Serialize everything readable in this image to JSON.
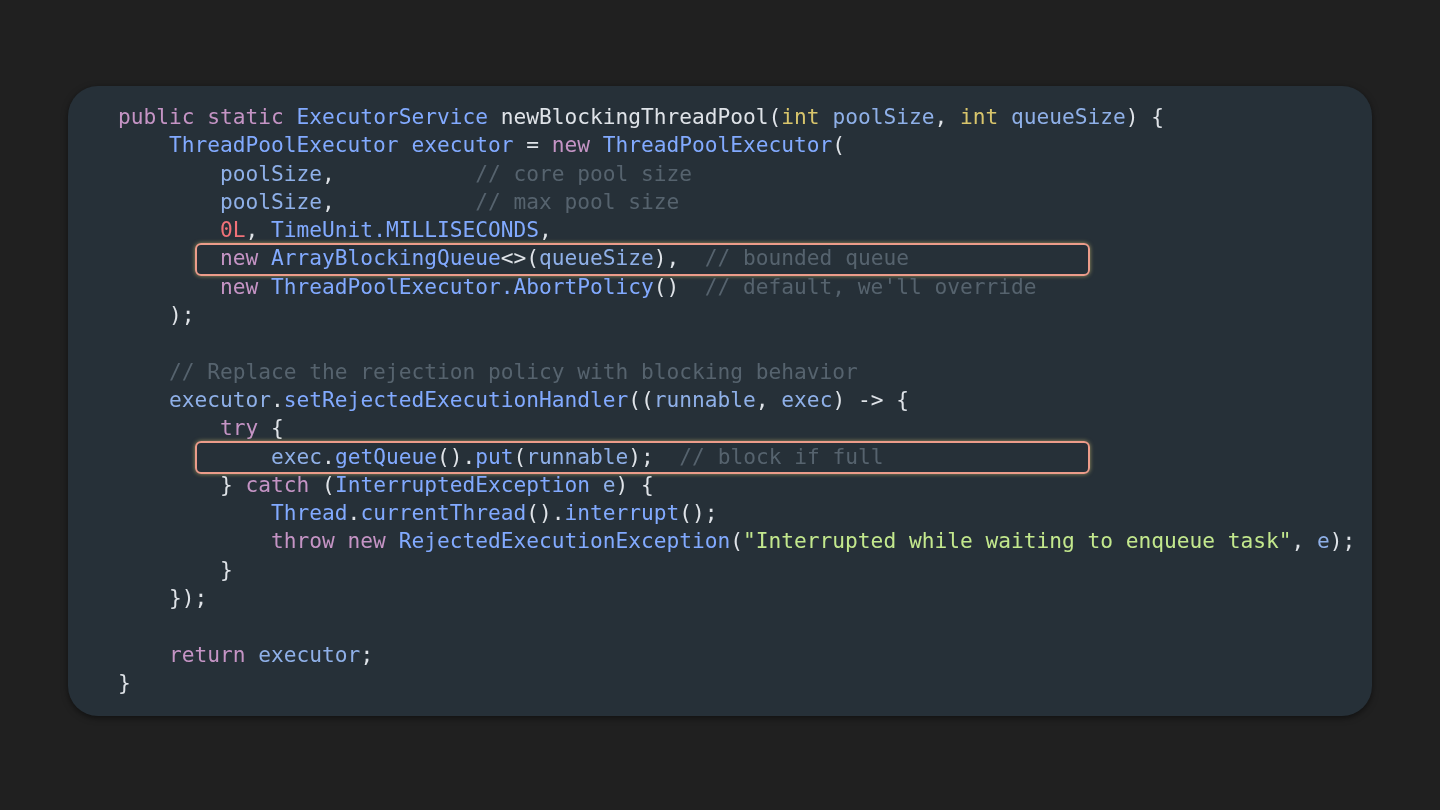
{
  "code_lines": [
    {
      "highlighted": false,
      "tokens": [
        {
          "kind": "keyword",
          "text": "public static "
        },
        {
          "kind": "type",
          "text": "ExecutorService "
        },
        {
          "kind": "plain",
          "text": "newBlockingThreadPool("
        },
        {
          "kind": "primitive",
          "text": "int "
        },
        {
          "kind": "ident",
          "text": "poolSize"
        },
        {
          "kind": "plain",
          "text": ", "
        },
        {
          "kind": "primitive",
          "text": "int "
        },
        {
          "kind": "ident",
          "text": "queueSize"
        },
        {
          "kind": "plain",
          "text": ") {"
        }
      ]
    },
    {
      "highlighted": false,
      "tokens": [
        {
          "kind": "type",
          "text": "    ThreadPoolExecutor executor "
        },
        {
          "kind": "plain",
          "text": "= "
        },
        {
          "kind": "keyword",
          "text": "new "
        },
        {
          "kind": "type",
          "text": "ThreadPoolExecutor"
        },
        {
          "kind": "plain",
          "text": "("
        }
      ]
    },
    {
      "highlighted": false,
      "tokens": [
        {
          "kind": "ident",
          "text": "        poolSize"
        },
        {
          "kind": "plain",
          "text": ",           "
        },
        {
          "kind": "comment",
          "text": "// core pool size"
        }
      ]
    },
    {
      "highlighted": false,
      "tokens": [
        {
          "kind": "ident",
          "text": "        poolSize"
        },
        {
          "kind": "plain",
          "text": ",           "
        },
        {
          "kind": "comment",
          "text": "// max pool size"
        }
      ]
    },
    {
      "highlighted": false,
      "tokens": [
        {
          "kind": "number",
          "text": "        0L"
        },
        {
          "kind": "plain",
          "text": ", "
        },
        {
          "kind": "type",
          "text": "TimeUnit.MILLISECONDS"
        },
        {
          "kind": "plain",
          "text": ","
        }
      ]
    },
    {
      "highlighted": true,
      "tokens": [
        {
          "kind": "keyword",
          "text": "        new "
        },
        {
          "kind": "type",
          "text": "ArrayBlockingQueue"
        },
        {
          "kind": "plain",
          "text": "<>("
        },
        {
          "kind": "ident",
          "text": "queueSize"
        },
        {
          "kind": "plain",
          "text": "),  "
        },
        {
          "kind": "comment",
          "text": "// bounded queue"
        }
      ]
    },
    {
      "highlighted": false,
      "tokens": [
        {
          "kind": "keyword",
          "text": "        new "
        },
        {
          "kind": "type",
          "text": "ThreadPoolExecutor.AbortPolicy"
        },
        {
          "kind": "plain",
          "text": "()  "
        },
        {
          "kind": "comment",
          "text": "// default, we'll override"
        }
      ]
    },
    {
      "highlighted": false,
      "tokens": [
        {
          "kind": "plain",
          "text": "    );"
        }
      ]
    },
    {
      "highlighted": false,
      "gap_before": true,
      "tokens": [
        {
          "kind": "comment",
          "text": "    // Replace the rejection policy with blocking behavior"
        }
      ]
    },
    {
      "highlighted": false,
      "tokens": [
        {
          "kind": "ident",
          "text": "    executor"
        },
        {
          "kind": "plain",
          "text": "."
        },
        {
          "kind": "type",
          "text": "setRejectedExecutionHandler"
        },
        {
          "kind": "plain",
          "text": "(("
        },
        {
          "kind": "ident",
          "text": "runnable"
        },
        {
          "kind": "plain",
          "text": ", "
        },
        {
          "kind": "ident",
          "text": "exec"
        },
        {
          "kind": "plain",
          "text": ") -> {"
        }
      ]
    },
    {
      "highlighted": false,
      "tokens": [
        {
          "kind": "keyword",
          "text": "        try "
        },
        {
          "kind": "plain",
          "text": "{"
        }
      ]
    },
    {
      "highlighted": true,
      "tokens": [
        {
          "kind": "ident",
          "text": "            exec"
        },
        {
          "kind": "plain",
          "text": "."
        },
        {
          "kind": "type",
          "text": "getQueue"
        },
        {
          "kind": "plain",
          "text": "()."
        },
        {
          "kind": "type",
          "text": "put"
        },
        {
          "kind": "plain",
          "text": "("
        },
        {
          "kind": "ident",
          "text": "runnable"
        },
        {
          "kind": "plain",
          "text": ");  "
        },
        {
          "kind": "comment",
          "text": "// block if full"
        }
      ]
    },
    {
      "highlighted": false,
      "tokens": [
        {
          "kind": "plain",
          "text": "        } "
        },
        {
          "kind": "keyword",
          "text": "catch "
        },
        {
          "kind": "plain",
          "text": "("
        },
        {
          "kind": "type",
          "text": "InterruptedException "
        },
        {
          "kind": "ident",
          "text": "e"
        },
        {
          "kind": "plain",
          "text": ") {"
        }
      ]
    },
    {
      "highlighted": false,
      "tokens": [
        {
          "kind": "type",
          "text": "            Thread"
        },
        {
          "kind": "plain",
          "text": "."
        },
        {
          "kind": "type",
          "text": "currentThread"
        },
        {
          "kind": "plain",
          "text": "()."
        },
        {
          "kind": "type",
          "text": "interrupt"
        },
        {
          "kind": "plain",
          "text": "();"
        }
      ]
    },
    {
      "highlighted": false,
      "tokens": [
        {
          "kind": "keyword",
          "text": "            throw new "
        },
        {
          "kind": "type",
          "text": "RejectedExecutionException"
        },
        {
          "kind": "plain",
          "text": "("
        },
        {
          "kind": "string",
          "text": "\"Interrupted while waiting to enqueue task\""
        },
        {
          "kind": "plain",
          "text": ", "
        },
        {
          "kind": "ident",
          "text": "e"
        },
        {
          "kind": "plain",
          "text": ");"
        }
      ]
    },
    {
      "highlighted": false,
      "tokens": [
        {
          "kind": "plain",
          "text": "        }"
        }
      ]
    },
    {
      "highlighted": false,
      "tokens": [
        {
          "kind": "plain",
          "text": "    });"
        }
      ]
    },
    {
      "highlighted": false,
      "gap_before": true,
      "tokens": [
        {
          "kind": "keyword",
          "text": "    return "
        },
        {
          "kind": "ident",
          "text": "executor"
        },
        {
          "kind": "plain",
          "text": ";"
        }
      ]
    },
    {
      "highlighted": false,
      "tokens": [
        {
          "kind": "plain",
          "text": "}"
        }
      ]
    }
  ]
}
